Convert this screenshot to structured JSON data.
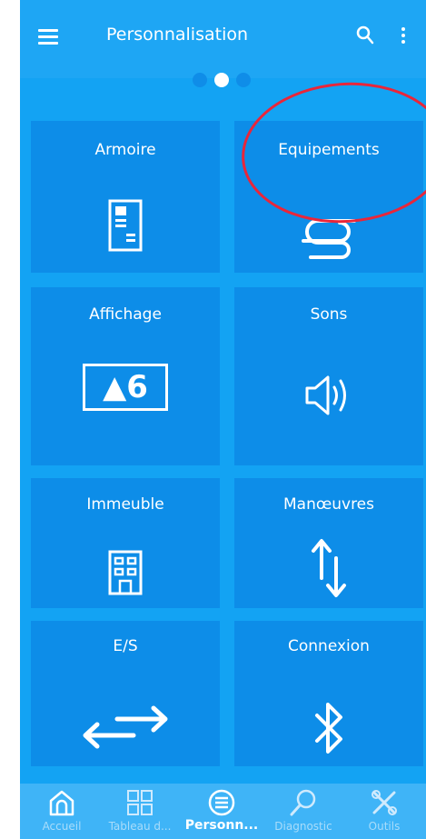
{
  "appbar": {
    "title": "Personnalisation",
    "menu_icon": "menu-icon",
    "search_icon": "search-icon",
    "more_icon": "more-vertical-icon"
  },
  "pager": {
    "count": 3,
    "active_index": 1
  },
  "tiles": [
    {
      "label": "Armoire",
      "icon": "document-icon"
    },
    {
      "label": "Equipements",
      "icon": "cable-icon"
    },
    {
      "label": "Affichage",
      "icon": "display-icon",
      "display_text": "▲6"
    },
    {
      "label": "Sons",
      "icon": "speaker-icon"
    },
    {
      "label": "Immeuble",
      "icon": "building-icon"
    },
    {
      "label": "Manœuvres",
      "icon": "up-down-arrows-icon"
    },
    {
      "label": "E/S",
      "icon": "swap-arrows-icon"
    },
    {
      "label": "Connexion",
      "icon": "bluetooth-icon"
    }
  ],
  "annotation": {
    "color": "#e9263a",
    "target": "Equipements"
  },
  "nav": [
    {
      "label": "Accueil",
      "icon": "home-icon",
      "active": false
    },
    {
      "label": "Tableau d...",
      "icon": "dashboard-icon",
      "active": false
    },
    {
      "label": "Personn...",
      "icon": "tune-icon",
      "active": true
    },
    {
      "label": "Diagnostic",
      "icon": "magnifier-icon",
      "active": false
    },
    {
      "label": "Outils",
      "icon": "tools-icon",
      "active": false
    }
  ],
  "colors": {
    "background": "#13a3f3",
    "tile": "#0d8de8",
    "navbar": "#3fb4f7",
    "accent": "#ffffff"
  }
}
